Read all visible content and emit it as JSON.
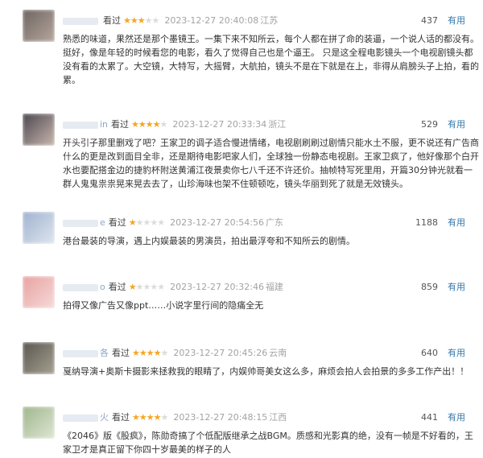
{
  "colors": {
    "star": "#f5a623",
    "link": "#3377aa",
    "meta": "#a3a3a3"
  },
  "reviews": [
    {
      "user_suffix": "",
      "seen": "看过",
      "rating": 3,
      "time": "2023-12-27 20:40:08",
      "location": "江苏",
      "votes": "437",
      "useful": "有用",
      "avatar_colors": [
        "#6d6460",
        "#b7a79e"
      ],
      "lines": [
        "熟悉的味道，果然还是那个墨镜王。一集下来不知所云，每个人都在拼了命的装逼，一个说人话的都没有。",
        "挺好，像是年轻的时候看您的电影，看久了觉得自己也是个逼王。 只是这全程电影镜头一个电视剧镜头都",
        "没有看的太累了。大空镜，大特写，大摇臂，大航拍，镜头不是在下就是在上，非得从肩膀头子上拍，看的",
        "累。"
      ]
    },
    {
      "user_suffix": "in",
      "seen": "看过",
      "rating": 4,
      "time": "2023-12-27 20:33:34",
      "location": "浙江",
      "votes": "529",
      "useful": "有用",
      "avatar_colors": [
        "#4b4650",
        "#c9b7ad"
      ],
      "lines": [
        "开头引子那里删戏了吧？王家卫的调子适合慢进情绪，电视剧刷刷过剧情只能水土不服，更不说还有广告商",
        "什么的更是改到面目全非，还是期待电影吧家人们，全球独一份静态电视剧。王家卫疯了，他好像那个白开",
        "水也要配搭金边的捷豹杯附送黄浦江夜景卖你七八千还不许还价。抽帧特写死里用，开篇30分钟光就看一",
        "群人鬼鬼祟祟晃来晃去去了，山珍海味也架不住顿顿吃，镜头华丽到死了就是无效镜头。"
      ]
    },
    {
      "user_suffix": "e",
      "seen": "看过",
      "rating": 1,
      "time": "2023-12-27 20:54:56",
      "location": "广东",
      "votes": "1188",
      "useful": "有用",
      "avatar_colors": [
        "#9fb2cf",
        "#dfe6ef"
      ],
      "lines": [
        "港台最装的导演，遇上内娱最装的男演员，拍出最浮夸和不知所云的剧情。"
      ]
    },
    {
      "user_suffix": "o",
      "seen": "看过",
      "rating": 1,
      "time": "2023-12-27 20:32:46",
      "location": "福建",
      "votes": "859",
      "useful": "有用",
      "avatar_colors": [
        "#e7a2a0",
        "#f6dada"
      ],
      "lines": [
        "拍得又像广告又像ppt……小说字里行间的隐痛全无"
      ]
    },
    {
      "user_suffix": "各",
      "seen": "看过",
      "rating": 4,
      "time": "2023-12-27 20:45:26",
      "location": "云南",
      "votes": "640",
      "useful": "有用",
      "avatar_colors": [
        "#58564f",
        "#a8a191"
      ],
      "lines": [
        "戛纳导演+奥斯卡摄影来拯救我的眼睛了，内娱帅哥美女这么多，麻烦会拍人会拍景的多多工作产出！！"
      ]
    },
    {
      "user_suffix": "火",
      "seen": "看过",
      "rating": 4,
      "time": "2023-12-27 20:48:15",
      "location": "江西",
      "votes": "441",
      "useful": "有用",
      "avatar_colors": [
        "#9fb68d",
        "#dfe6d3"
      ],
      "lines": [
        "《2046》版《股疯》，陈勋奇搞了个低配版继承之战BGM。质感和光影真的绝，没有一帧是不好看的，王",
        "家卫才是真正留下你四十岁最美的样子的人"
      ]
    }
  ]
}
